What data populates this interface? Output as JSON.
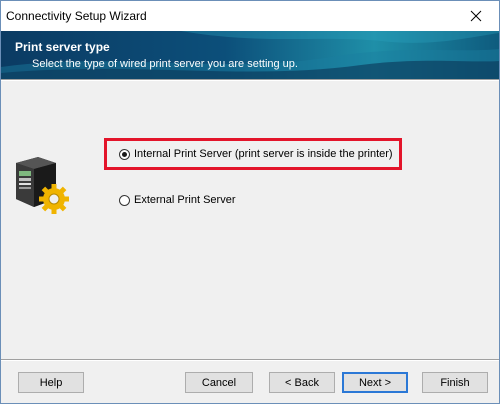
{
  "window": {
    "title": "Connectivity Setup Wizard",
    "close_icon": "close-icon"
  },
  "banner": {
    "heading": "Print server type",
    "subtitle": "Select the type of wired print server you are setting up."
  },
  "options": [
    {
      "label": "Internal Print Server (print server is inside the printer)",
      "selected": true
    },
    {
      "label": "External Print Server",
      "selected": false
    }
  ],
  "highlight_color": "#e3142a",
  "icons": {
    "printer": "printer-gear-icon"
  },
  "buttons": {
    "help": "Help",
    "cancel": "Cancel",
    "back": "< Back",
    "next": "Next >",
    "finish": "Finish"
  }
}
